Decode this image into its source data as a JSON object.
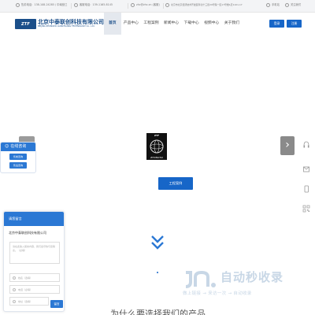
{
  "topbar": {
    "phone": "售前电话：138-108-24285 / 中南营江",
    "service": "客服电话：139-1165-8145",
    "email": "zhc@zhc.cn (客服)",
    "address": "北京市北京经济技术开发区科创十三街29号院一区17号楼1层1101-17",
    "mobile": "手机站",
    "favorite": "关注我们"
  },
  "header": {
    "logo_text": "ZTF",
    "company_name": "北京中泰联创科技有限公司",
    "company_en": "BEIJING ZHONGTAI LIANCHUANG TECHNOLOGY Co., Ltd.",
    "nav": [
      "首页",
      "产品中心",
      "工程案例",
      "新闻中心",
      "下载中心",
      "视频中心",
      "关于我们"
    ],
    "login_label": "登录",
    "register_label": "注册"
  },
  "hero": {
    "center_logo_top": "ZTF",
    "center_logo_bottom": "ZHONGTAI",
    "project_button": "工程案例"
  },
  "online_service": {
    "title": "在线咨询",
    "buttons": [
      "售前咨询",
      "售后咨询"
    ]
  },
  "message_form": {
    "title": "请您留言",
    "company": "北京中泰联创科技有限公司",
    "content_placeholder": "请在此输入留言内容，我们会尽快与您联系。（必填）",
    "name_placeholder": "姓名（选填）",
    "phone_placeholder": "电话（必填）",
    "address_placeholder": "地址（选填）",
    "submit_label": "留言"
  },
  "watermark": {
    "brand": "自动秒收录",
    "slogan": "做上链接 → 来访一次 → 自动收录"
  },
  "bottom_title": "为什么要选择我们的产品",
  "colors": {
    "brand_blue": "#1766c8",
    "widget_blue": "#2b78d4",
    "logo_navy": "#1b4f8a"
  }
}
